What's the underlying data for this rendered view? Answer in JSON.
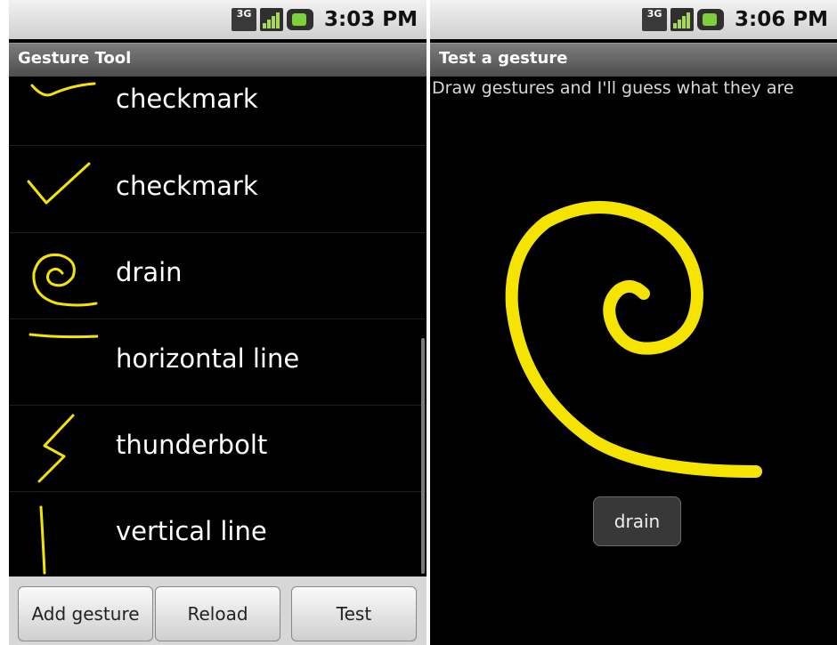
{
  "left": {
    "status": {
      "network": "3G",
      "time": "3:03 PM"
    },
    "app_title": "Gesture Tool",
    "gestures": [
      {
        "name": "checkmark",
        "icon": "checkmark-gesture-icon"
      },
      {
        "name": "checkmark",
        "icon": "checkmark-gesture-icon"
      },
      {
        "name": "drain",
        "icon": "spiral-gesture-icon"
      },
      {
        "name": "horizontal line",
        "icon": "horizontal-line-gesture-icon"
      },
      {
        "name": "thunderbolt",
        "icon": "thunderbolt-gesture-icon"
      },
      {
        "name": "vertical line",
        "icon": "vertical-line-gesture-icon"
      }
    ],
    "buttons": {
      "add": "Add gesture",
      "reload": "Reload",
      "test": "Test"
    }
  },
  "right": {
    "status": {
      "network": "3G",
      "time": "3:06 PM"
    },
    "app_title": "Test a gesture",
    "instruction": "Draw gestures and I'll guess what they are",
    "result": "drain"
  },
  "colors": {
    "gesture_stroke": "#f5e400",
    "background": "#000000",
    "titlebar": "#5a5a5a"
  }
}
